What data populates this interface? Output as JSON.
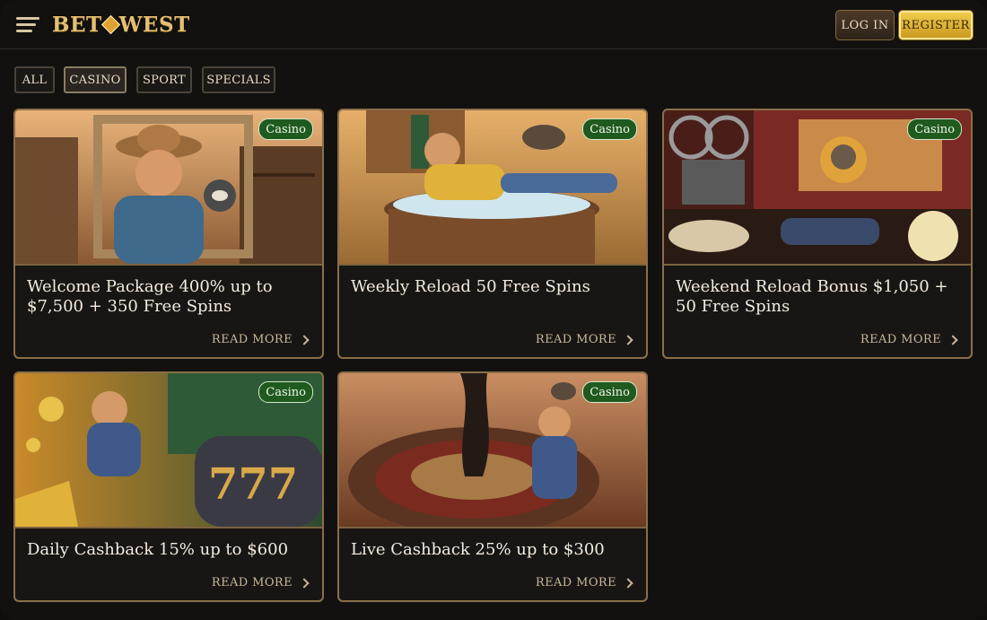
{
  "header": {
    "logo_text": "BET WEST",
    "login_label": "LOG IN",
    "register_label": "REGISTER"
  },
  "filters": [
    {
      "label": "ALL",
      "active": false
    },
    {
      "label": "CASINO",
      "active": true
    },
    {
      "label": "SPORT",
      "active": false
    },
    {
      "label": "SPECIALS",
      "active": false
    }
  ],
  "promotions": [
    {
      "badge": "Casino",
      "title": "Welcome Package 400% up to $7,500 + 350 Free Spins",
      "read_more": "READ MORE",
      "art": "cowboy-and-raccoon-wanted-poster"
    },
    {
      "badge": "Casino",
      "title": "Weekly Reload 50 Free Spins",
      "read_more": "READ MORE",
      "art": "cowboy-in-ice-bath-with-raccoon"
    },
    {
      "badge": "Casino",
      "title": "Weekend Reload Bonus $1,050 + 50 Free Spins",
      "read_more": "READ MORE",
      "art": "cinema-projector-and-popcorn"
    },
    {
      "badge": "Casino",
      "title": "Daily Cashback 15% up to $600",
      "read_more": "READ MORE",
      "art": "cowboy-on-train-with-slot-reels"
    },
    {
      "badge": "Casino",
      "title": "Live Cashback 25% up to $300",
      "read_more": "READ MORE",
      "art": "cowboy-with-roulette-wheel-oil-gusher"
    }
  ],
  "colors": {
    "background": "#121110",
    "card_border": "#8a6e48",
    "badge_green": "#1f5a1e",
    "register_gold": "#e2b43a"
  }
}
